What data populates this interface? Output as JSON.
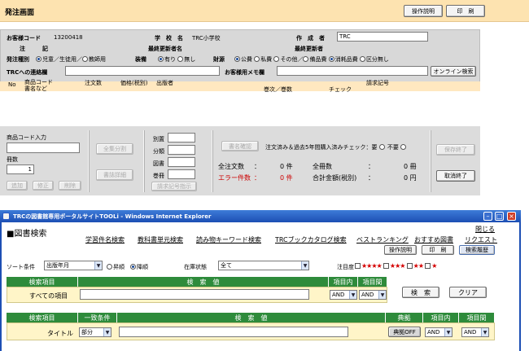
{
  "header": {
    "title": "発注画面",
    "help_label": "操作説明",
    "print_label": "印　刷"
  },
  "order": {
    "customer_code_label": "お客様コード",
    "customer_code": "13200418",
    "school_label": "学　校　名",
    "school_name": "TRC小学校",
    "creator_label": "作　成　者",
    "creator_value": "TRC",
    "note_label": "注　　　記",
    "last_updater_name_label": "最終更新者名",
    "last_updater_label": "最終更新者",
    "order_type_label": "発注種別",
    "order_type_options": [
      "児童／生徒用",
      "教師用"
    ],
    "binding_label": "装備",
    "binding_options": [
      "有り",
      "無し"
    ],
    "funding_label": "財源",
    "funding_options": [
      "公費",
      "私費",
      "その他",
      "備品費",
      "消耗品費",
      "区分無し"
    ],
    "trc_contact_label": "TRCへの連絡欄",
    "customer_memo_label": "お客様用メモ欄",
    "online_search_label": "オンライン検索",
    "col_no": "No",
    "col_code": "商品コード",
    "col_code_sub": "書名など",
    "col_qty": "注文数",
    "col_price": "価格(税別)",
    "col_publisher": "出版者",
    "col_volume": "巻次／巻数",
    "col_check": "チェック",
    "col_request": "請求記号"
  },
  "entry": {
    "product_code_label": "商品コード入力",
    "copies_label": "冊数",
    "copies_value": "1",
    "add_label": "追加",
    "fix_label": "修正",
    "delete_label": "削除",
    "all_split_label": "全集分割",
    "detail_label": "書誌詳細",
    "fields": [
      "別置",
      "分類",
      "図書",
      "巻冊"
    ],
    "request_display_label": "請求記号指示",
    "title_confirm_label": "書名確認",
    "purchase_check_label": "注文済み＆過去5年間購入済みチェック：要",
    "purchase_check_no": "不要",
    "total_orders_label": "全注文数",
    "total_orders_value": "0 件",
    "total_books_label": "全冊数",
    "total_books_value": "0 冊",
    "error_label": "エラー件数",
    "error_value": "0 件",
    "total_amount_label": "合計金額(税別)",
    "total_amount_value": "0 円",
    "save_end_label": "保存終了",
    "cancel_end_label": "取消終了"
  },
  "ie": {
    "window_title": "TRCの図書館専用ポータルサイトTOOLi - Windows Internet Explorer",
    "section_title": "■図書検索",
    "close_label": "閉じる",
    "nav_links": [
      "学習件名検索",
      "教科書単元検索",
      "読み物キーワード検索",
      "TRCブックカタログ検索",
      "ベストランキング",
      "おすすめ図書",
      "リクエスト"
    ],
    "help_label": "操作説明",
    "print_label": "印　刷",
    "history_label": "検索履歴",
    "sort_label": "ソート条件",
    "sort_value": "出版年月",
    "asc_label": "昇順",
    "desc_label": "降順",
    "stock_label": "在庫状態",
    "stock_value": "全て",
    "attention_label": "注目度",
    "search_item_label": "検索項目",
    "search_value_label": "検　索　値",
    "within_label": "項目内",
    "between_label": "項目間",
    "all_items_label": "すべての項目",
    "and_label": "AND",
    "search_label": "検　索",
    "clear_label": "クリア",
    "match_label": "一致条件",
    "source_label": "典拠",
    "title_label": "タイトル",
    "partial_label": "部分",
    "source_off_label": "典拠OFF",
    "accent_green": "#2e8b3b",
    "title_bar_blue": "#1d4fb4"
  }
}
